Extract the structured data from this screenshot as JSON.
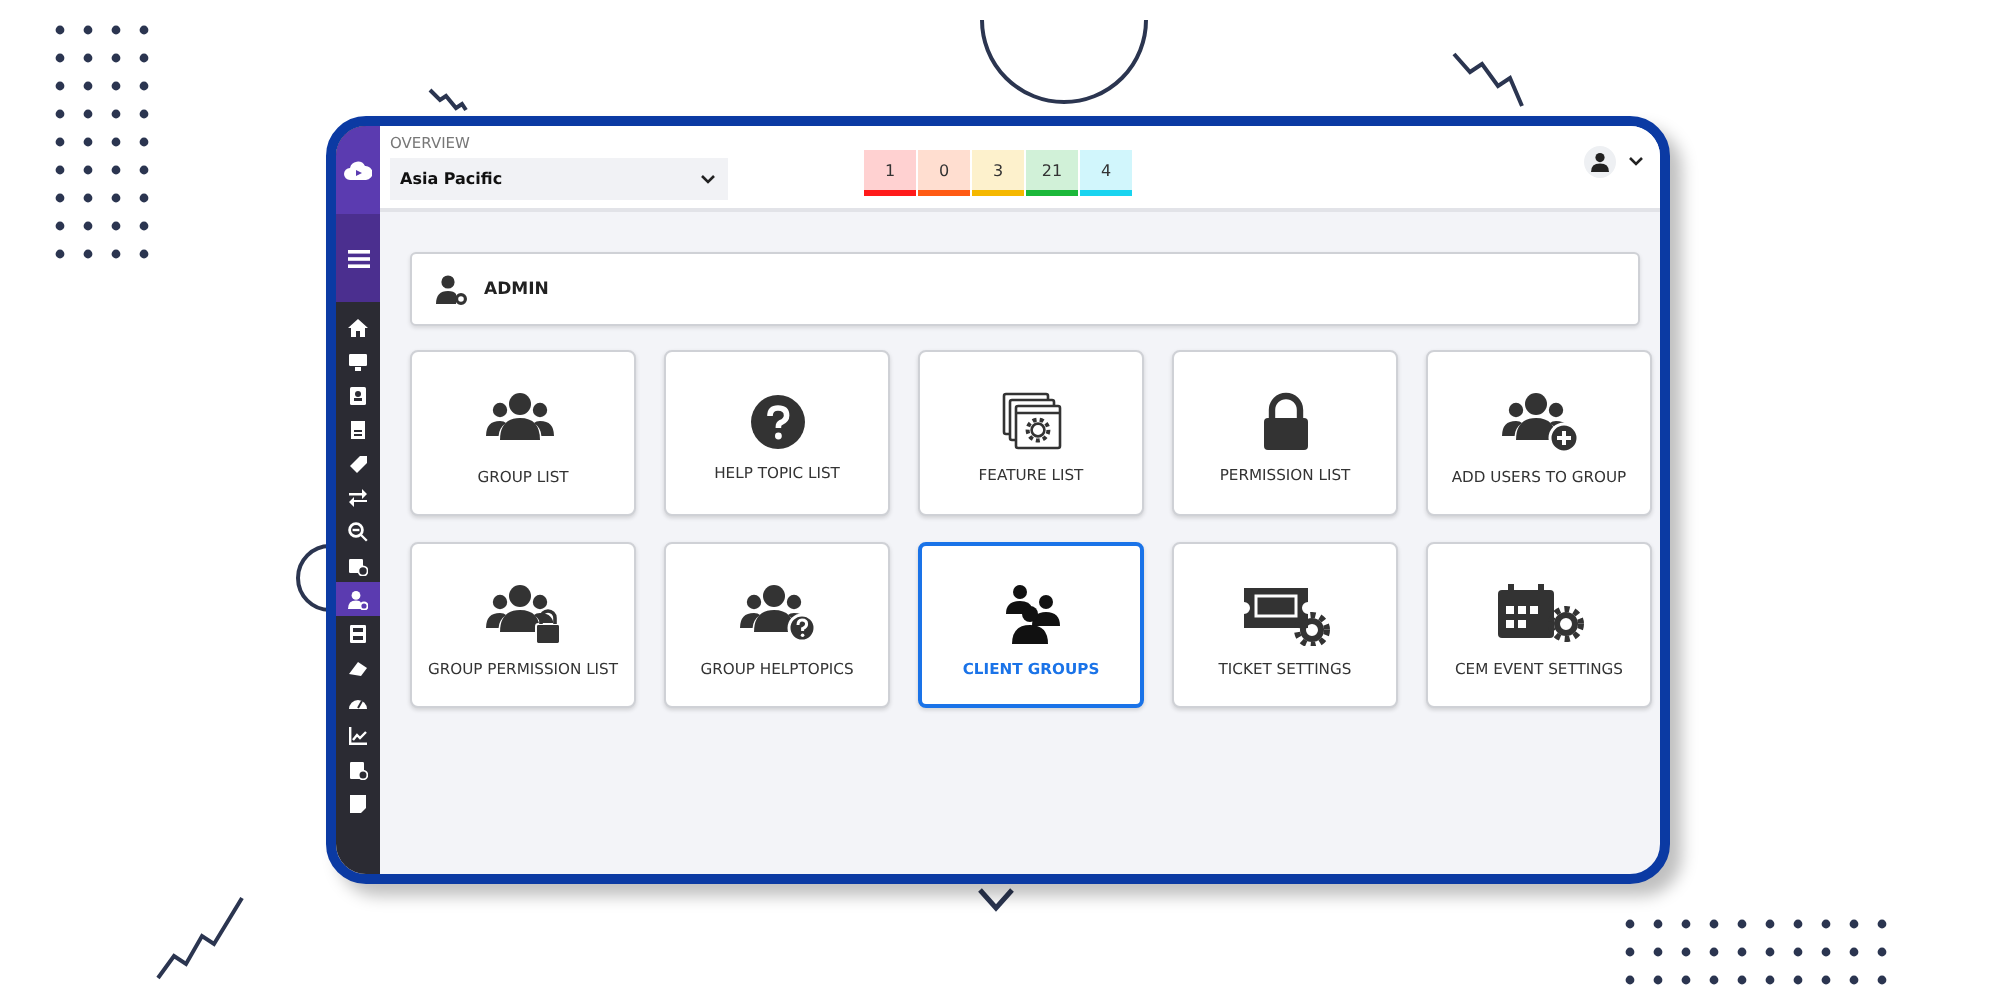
{
  "header": {
    "label": "OVERVIEW",
    "region": {
      "value": "Asia Pacific"
    },
    "counters": [
      {
        "value": "1",
        "color": "#ff1a1a"
      },
      {
        "value": "0",
        "color": "#ff5a14"
      },
      {
        "value": "3",
        "color": "#f5b800"
      },
      {
        "value": "21",
        "color": "#1bb83a"
      },
      {
        "value": "4",
        "color": "#19d4f0"
      }
    ]
  },
  "sidebar": {
    "items": [
      {
        "selected": false
      },
      {
        "selected": false
      },
      {
        "selected": false
      },
      {
        "selected": false
      },
      {
        "selected": false
      },
      {
        "selected": false
      },
      {
        "selected": false
      },
      {
        "selected": false
      },
      {
        "selected": true
      },
      {
        "selected": false
      },
      {
        "selected": false
      },
      {
        "selected": false
      },
      {
        "selected": false
      },
      {
        "selected": false
      },
      {
        "selected": false
      }
    ]
  },
  "section": {
    "title": "ADMIN"
  },
  "tiles": [
    {
      "label": "GROUP LIST",
      "selected": false
    },
    {
      "label": "HELP TOPIC LIST",
      "selected": false
    },
    {
      "label": "FEATURE LIST",
      "selected": false
    },
    {
      "label": "PERMISSION LIST",
      "selected": false
    },
    {
      "label": "ADD USERS TO GROUP",
      "selected": false
    },
    {
      "label": "GROUP PERMISSION LIST",
      "selected": false
    },
    {
      "label": "GROUP HELPTOPICS",
      "selected": false
    },
    {
      "label": "CLIENT GROUPS",
      "selected": true
    },
    {
      "label": "TICKET SETTINGS",
      "selected": false
    },
    {
      "label": "CEM EVENT SETTINGS",
      "selected": false
    }
  ]
}
